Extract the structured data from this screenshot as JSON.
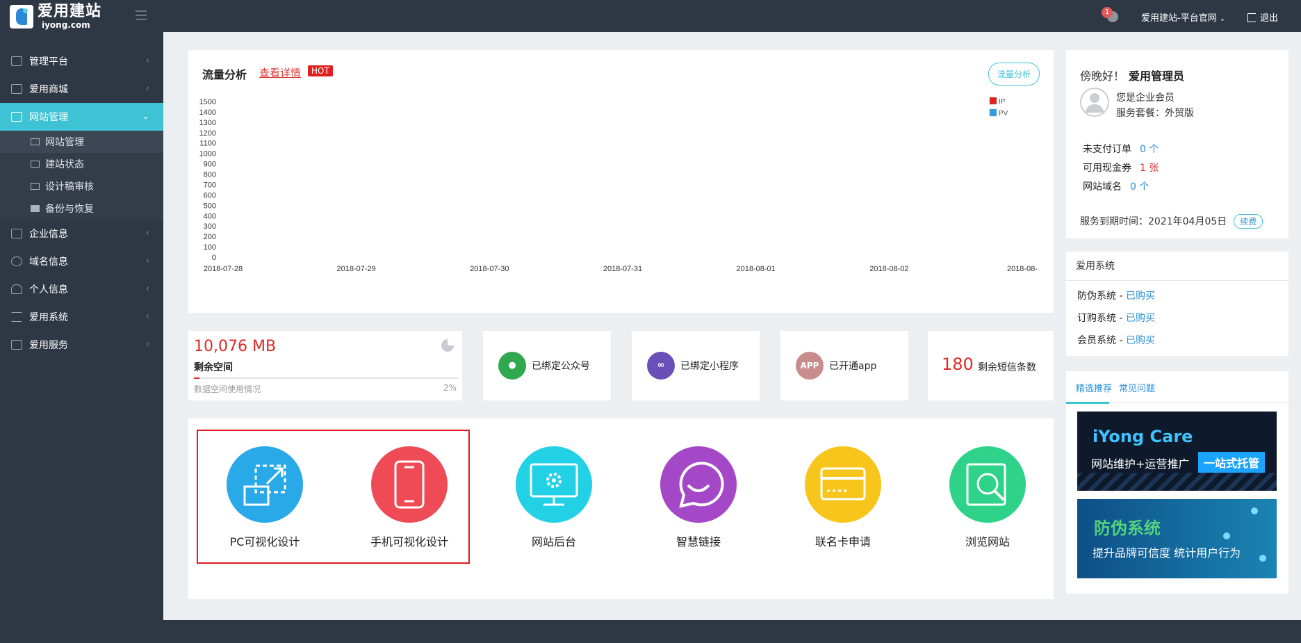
{
  "header": {
    "logo_cn": "爱用建站",
    "logo_en": "iyong.com",
    "notification_count": "1",
    "site_link": "爱用建站-平台官网",
    "logout": "退出"
  },
  "sidebar": {
    "items": [
      {
        "label": "管理平台",
        "icon": "home-icon"
      },
      {
        "label": "爱用商城",
        "icon": "cart-icon"
      },
      {
        "label": "网站管理",
        "icon": "laptop-icon"
      },
      {
        "label": "企业信息",
        "icon": "building-icon"
      },
      {
        "label": "域名信息",
        "icon": "globe-icon"
      },
      {
        "label": "个人信息",
        "icon": "user-icon"
      },
      {
        "label": "爱用系统",
        "icon": "list-icon"
      },
      {
        "label": "爱用服务",
        "icon": "bag-icon"
      }
    ],
    "sub_items": [
      {
        "label": "网站管理",
        "icon": "laptop-icon"
      },
      {
        "label": "建站状态",
        "icon": "bar-chart-icon"
      },
      {
        "label": "设计稿审核",
        "icon": "image-icon"
      },
      {
        "label": "备份与恢复",
        "icon": "database-icon"
      }
    ]
  },
  "traffic": {
    "title": "流量分析",
    "detail_link": "查看详情",
    "hot": "HOT",
    "button": "流量分析"
  },
  "chart_data": {
    "type": "line",
    "title": "",
    "x": [
      "2018-07-28",
      "2018-07-29",
      "2018-07-30",
      "2018-07-31",
      "2018-08-01",
      "2018-08-02",
      "2018-08-"
    ],
    "yticks": [
      "0",
      "100",
      "200",
      "300",
      "400",
      "500",
      "600",
      "700",
      "800",
      "900",
      "1000",
      "1100",
      "1200",
      "1300",
      "1400",
      "1500"
    ],
    "ylim": [
      0,
      1500
    ],
    "series": [
      {
        "name": "IP",
        "color": "#e0201f",
        "values": [
          0,
          0,
          0,
          0,
          0,
          0,
          0
        ]
      },
      {
        "name": "PV",
        "color": "#2e9ee0",
        "values": [
          0,
          0,
          0,
          0,
          0,
          0,
          0
        ]
      }
    ],
    "legend": "top-right",
    "grid": false
  },
  "stats": {
    "space_value": "10,076 MB",
    "space_label": "剩余空间",
    "space_usage_label": "数据空间使用情况",
    "space_pct": "2%",
    "space_fraction": 0.02,
    "wechat": "已绑定公众号",
    "miniprogram": "已绑定小程序",
    "app_icon_text": "APP",
    "app": "已开通app",
    "sms_count": "180",
    "sms_label": "剩余短信条数"
  },
  "apps": [
    {
      "label": "PC可视化设计",
      "color": "#2aa9e8",
      "icon": "resize-icon"
    },
    {
      "label": "手机可视化设计",
      "color": "#ef4b57",
      "icon": "mobile-icon"
    },
    {
      "label": "网站后台",
      "color": "#22d1e6",
      "icon": "monitor-gear-icon"
    },
    {
      "label": "智慧链接",
      "color": "#a448c8",
      "icon": "chat-smile-icon"
    },
    {
      "label": "联名卡申请",
      "color": "#f7c51b",
      "icon": "card-icon"
    },
    {
      "label": "浏览网站",
      "color": "#2ed389",
      "icon": "browse-icon"
    }
  ],
  "welcome": {
    "greeting": "傍晚好！",
    "username": "爱用管理员",
    "member_type": "您是企业会员",
    "package": "服务套餐：外贸版",
    "unpaid_label": "未支付订单",
    "unpaid_value": "0 个",
    "coupon_label": "可用现金券",
    "coupon_value": "1 张",
    "domain_label": "网站域名",
    "domain_value": "0 个",
    "expire_label": "服务到期时间：2021年04月05日",
    "renew": "续费"
  },
  "systems": {
    "title": "爱用系统",
    "rows": [
      {
        "name": "防伪系统 - ",
        "status": "已购买"
      },
      {
        "name": "订购系统 - ",
        "status": "已购买"
      },
      {
        "name": "会员系统 - ",
        "status": "已购买"
      }
    ]
  },
  "recommend": {
    "tabs": [
      "精选推荐",
      "常见问题"
    ],
    "banner1_title": "iYong Care",
    "banner1_sub": "网站维护+运营推广",
    "banner1_tag": "一站式托管",
    "banner2_title": "防伪系统",
    "banner2_sub": "提升品牌可信度 统计用户行为"
  },
  "colors": {
    "accent": "#3ec3d4",
    "danger": "#e02828",
    "sidebar": "#2e3744"
  }
}
